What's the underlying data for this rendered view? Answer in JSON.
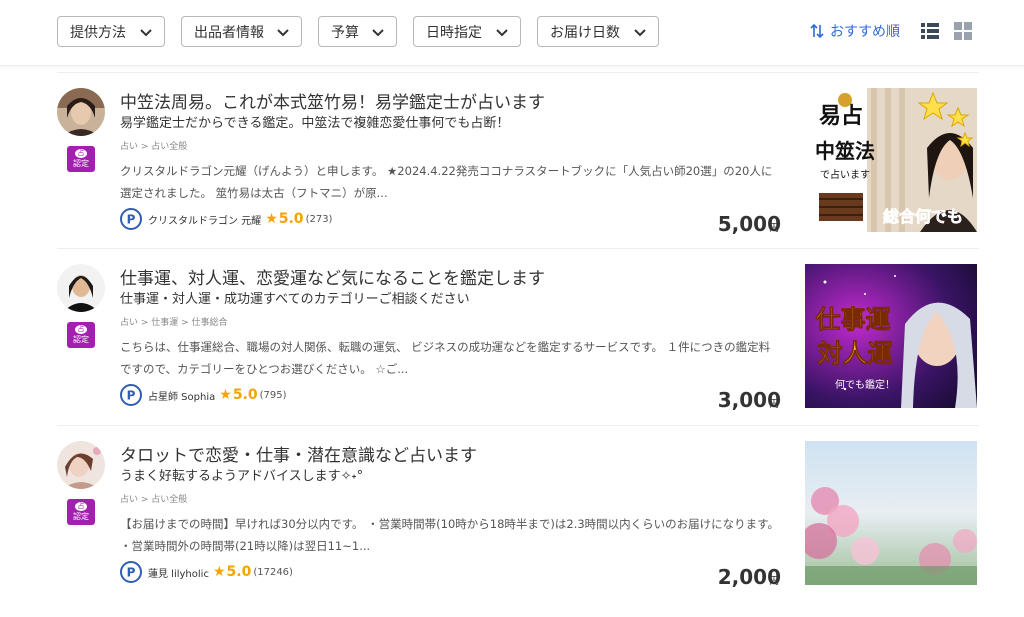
{
  "filters": [
    {
      "label": "提供方法"
    },
    {
      "label": "出品者情報"
    },
    {
      "label": "予算"
    },
    {
      "label": "日時指定"
    },
    {
      "label": "お届け日数"
    }
  ],
  "sort": {
    "label": "おすすめ順"
  },
  "badge": {
    "top": "占",
    "bottom": "認定"
  },
  "colors": {
    "accent": "#2e6cd1",
    "badge": "#a31fb0",
    "star": "#f5a300"
  },
  "listings": [
    {
      "title": "中笠法周易。これが本式筮竹易！易学鑑定士が占います",
      "subtitle": "易学鑑定士だからできる鑑定。中筮法で複雑恋愛仕事何でも占断！",
      "breadcrumb": "占い > 占い全般",
      "description": "クリスタルドラゴン元耀（げんよう）と申します。 ★2024.4.22発売ココナラスタートブックに「人気占い師20選」の20人に選定されました。 筮竹易は太古（フトマニ）が原...",
      "seller": "クリスタルドラゴン 元耀",
      "rating": "5.0",
      "review_count": "(273)",
      "price": "5,000",
      "currency": "円",
      "thumb_text": {
        "l1": "易占",
        "l2": "中筮法",
        "l3": "で占います",
        "l4": "総合何でも"
      }
    },
    {
      "title": "仕事運、対人運、恋愛運など気になることを鑑定します",
      "subtitle": "仕事運・対人運・成功運すべてのカテゴリーご相談ください",
      "breadcrumb": "占い > 仕事運 > 仕事総合",
      "description": "こちらは、仕事運総合、職場の対人関係、転職の運気、 ビジネスの成功運などを鑑定するサービスです。 １件につきの鑑定料ですので、カテゴリーをひとつお選びください。 ☆ご...",
      "seller": "占星師 Sophia",
      "rating": "5.0",
      "review_count": "(795)",
      "price": "3,000",
      "currency": "円",
      "thumb_text": {
        "l1": "仕事運",
        "l2": "対人運",
        "l3": "何でも鑑定！"
      }
    },
    {
      "title": "タロットで恋愛・仕事・潜在意識など占います",
      "subtitle": "うまく好転するようアドバイスします✧˖°",
      "breadcrumb": "占い > 占い全般",
      "description": "【お届けまでの時間】早ければ30分以内です。 ・営業時間帯(10時から18時半まで)は2.3時間以内くらいのお届けになります。 ・営業時間外の時間帯(21時以降)は翌日11~1...",
      "seller": "蓮見 lilyholic",
      "rating": "5.0",
      "review_count": "(17246)",
      "price": "2,000",
      "currency": "円"
    }
  ]
}
